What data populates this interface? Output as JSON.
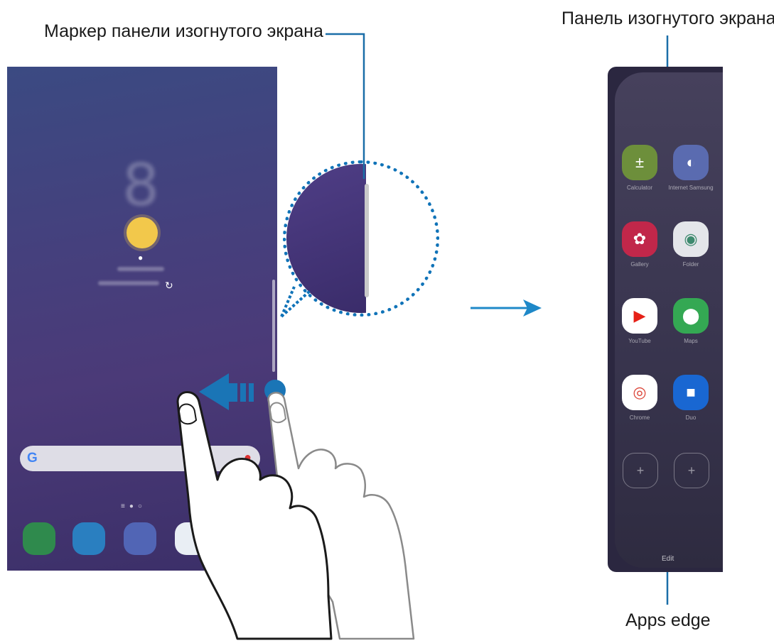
{
  "labels": {
    "edge_handle": "Маркер панели изогнутого экрана",
    "edge_panel": "Панель изогнутого экрана",
    "apps_edge": "Apps edge"
  },
  "home_screen": {
    "search_logo": "G",
    "dock_apps": [
      "phone-icon",
      "messages-icon",
      "internet-icon",
      "contacts-icon"
    ]
  },
  "edge_panel": {
    "apps": [
      {
        "name": "Calculator",
        "icon": "calculator-icon",
        "color": "#6d8f3b"
      },
      {
        "name": "Internet Samsung",
        "icon": "internet-samsung-icon",
        "color": "#5a6bb0"
      },
      {
        "name": "Gallery",
        "icon": "gallery-icon",
        "color": "#c1274a"
      },
      {
        "name": "Folder",
        "icon": "folder-icon",
        "color": "#e4e6ea"
      },
      {
        "name": "YouTube",
        "icon": "youtube-icon",
        "color": "#e62117"
      },
      {
        "name": "Maps",
        "icon": "maps-icon",
        "color": "#34a853"
      },
      {
        "name": "Chrome",
        "icon": "chrome-icon",
        "color": "#ffffff"
      },
      {
        "name": "Duo",
        "icon": "duo-icon",
        "color": "#1967d2"
      }
    ],
    "edit_label": "Edit"
  },
  "colors": {
    "accent": "#1073b8",
    "callout_line": "#1a6ea8"
  }
}
